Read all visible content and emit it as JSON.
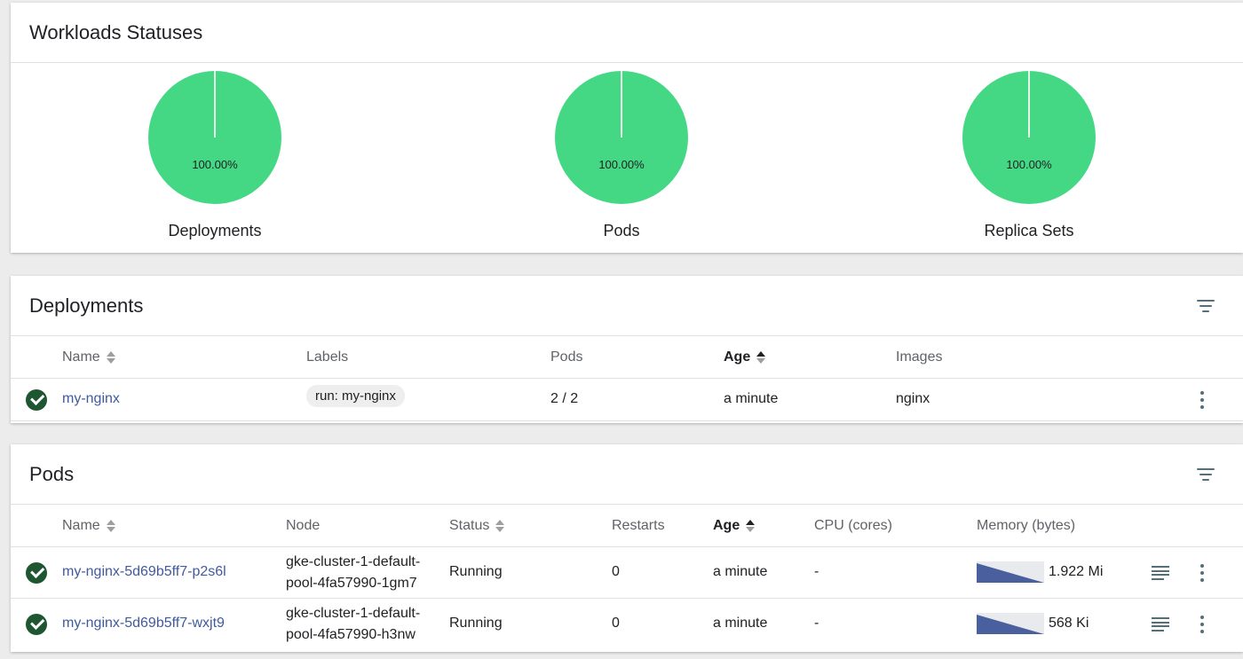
{
  "workloads": {
    "title": "Workloads Statuses",
    "charts": [
      {
        "name": "Deployments",
        "label": "100.00%",
        "value": 100
      },
      {
        "name": "Pods",
        "label": "100.00%",
        "value": 100
      },
      {
        "name": "Replica Sets",
        "label": "100.00%",
        "value": 100
      }
    ],
    "color": "#44d884"
  },
  "deployments": {
    "title": "Deployments",
    "columns": [
      "Name",
      "Labels",
      "Pods",
      "Age",
      "Images"
    ],
    "rows": [
      {
        "status": "check-circle-icon",
        "name": "my-nginx",
        "labels": "run: my-nginx",
        "pods": "2 / 2",
        "age": "a minute",
        "images": "nginx"
      }
    ]
  },
  "pods": {
    "title": "Pods",
    "columns": [
      "Name",
      "Node",
      "Status",
      "Restarts",
      "Age",
      "CPU (cores)",
      "Memory (bytes)"
    ],
    "rows": [
      {
        "status": "check-circle-icon",
        "name": "my-nginx-5d69b5ff7-p2s6l",
        "node_line1": "gke-cluster-1-default-",
        "node_line2": "pool-4fa57990-1gm7",
        "state": "Running",
        "restarts": "0",
        "age": "a minute",
        "cpu": "-",
        "memory": "1.922 Mi"
      },
      {
        "status": "check-circle-icon",
        "name": "my-nginx-5d69b5ff7-wxjt9",
        "node_line1": "gke-cluster-1-default-",
        "node_line2": "pool-4fa57990-h3nw",
        "state": "Running",
        "restarts": "0",
        "age": "a minute",
        "cpu": "-",
        "memory": "568 Ki"
      }
    ]
  },
  "colors": {
    "status_ok": "#1e5631",
    "link": "#3f5a9e",
    "sparkline": "#4a5f9e"
  }
}
